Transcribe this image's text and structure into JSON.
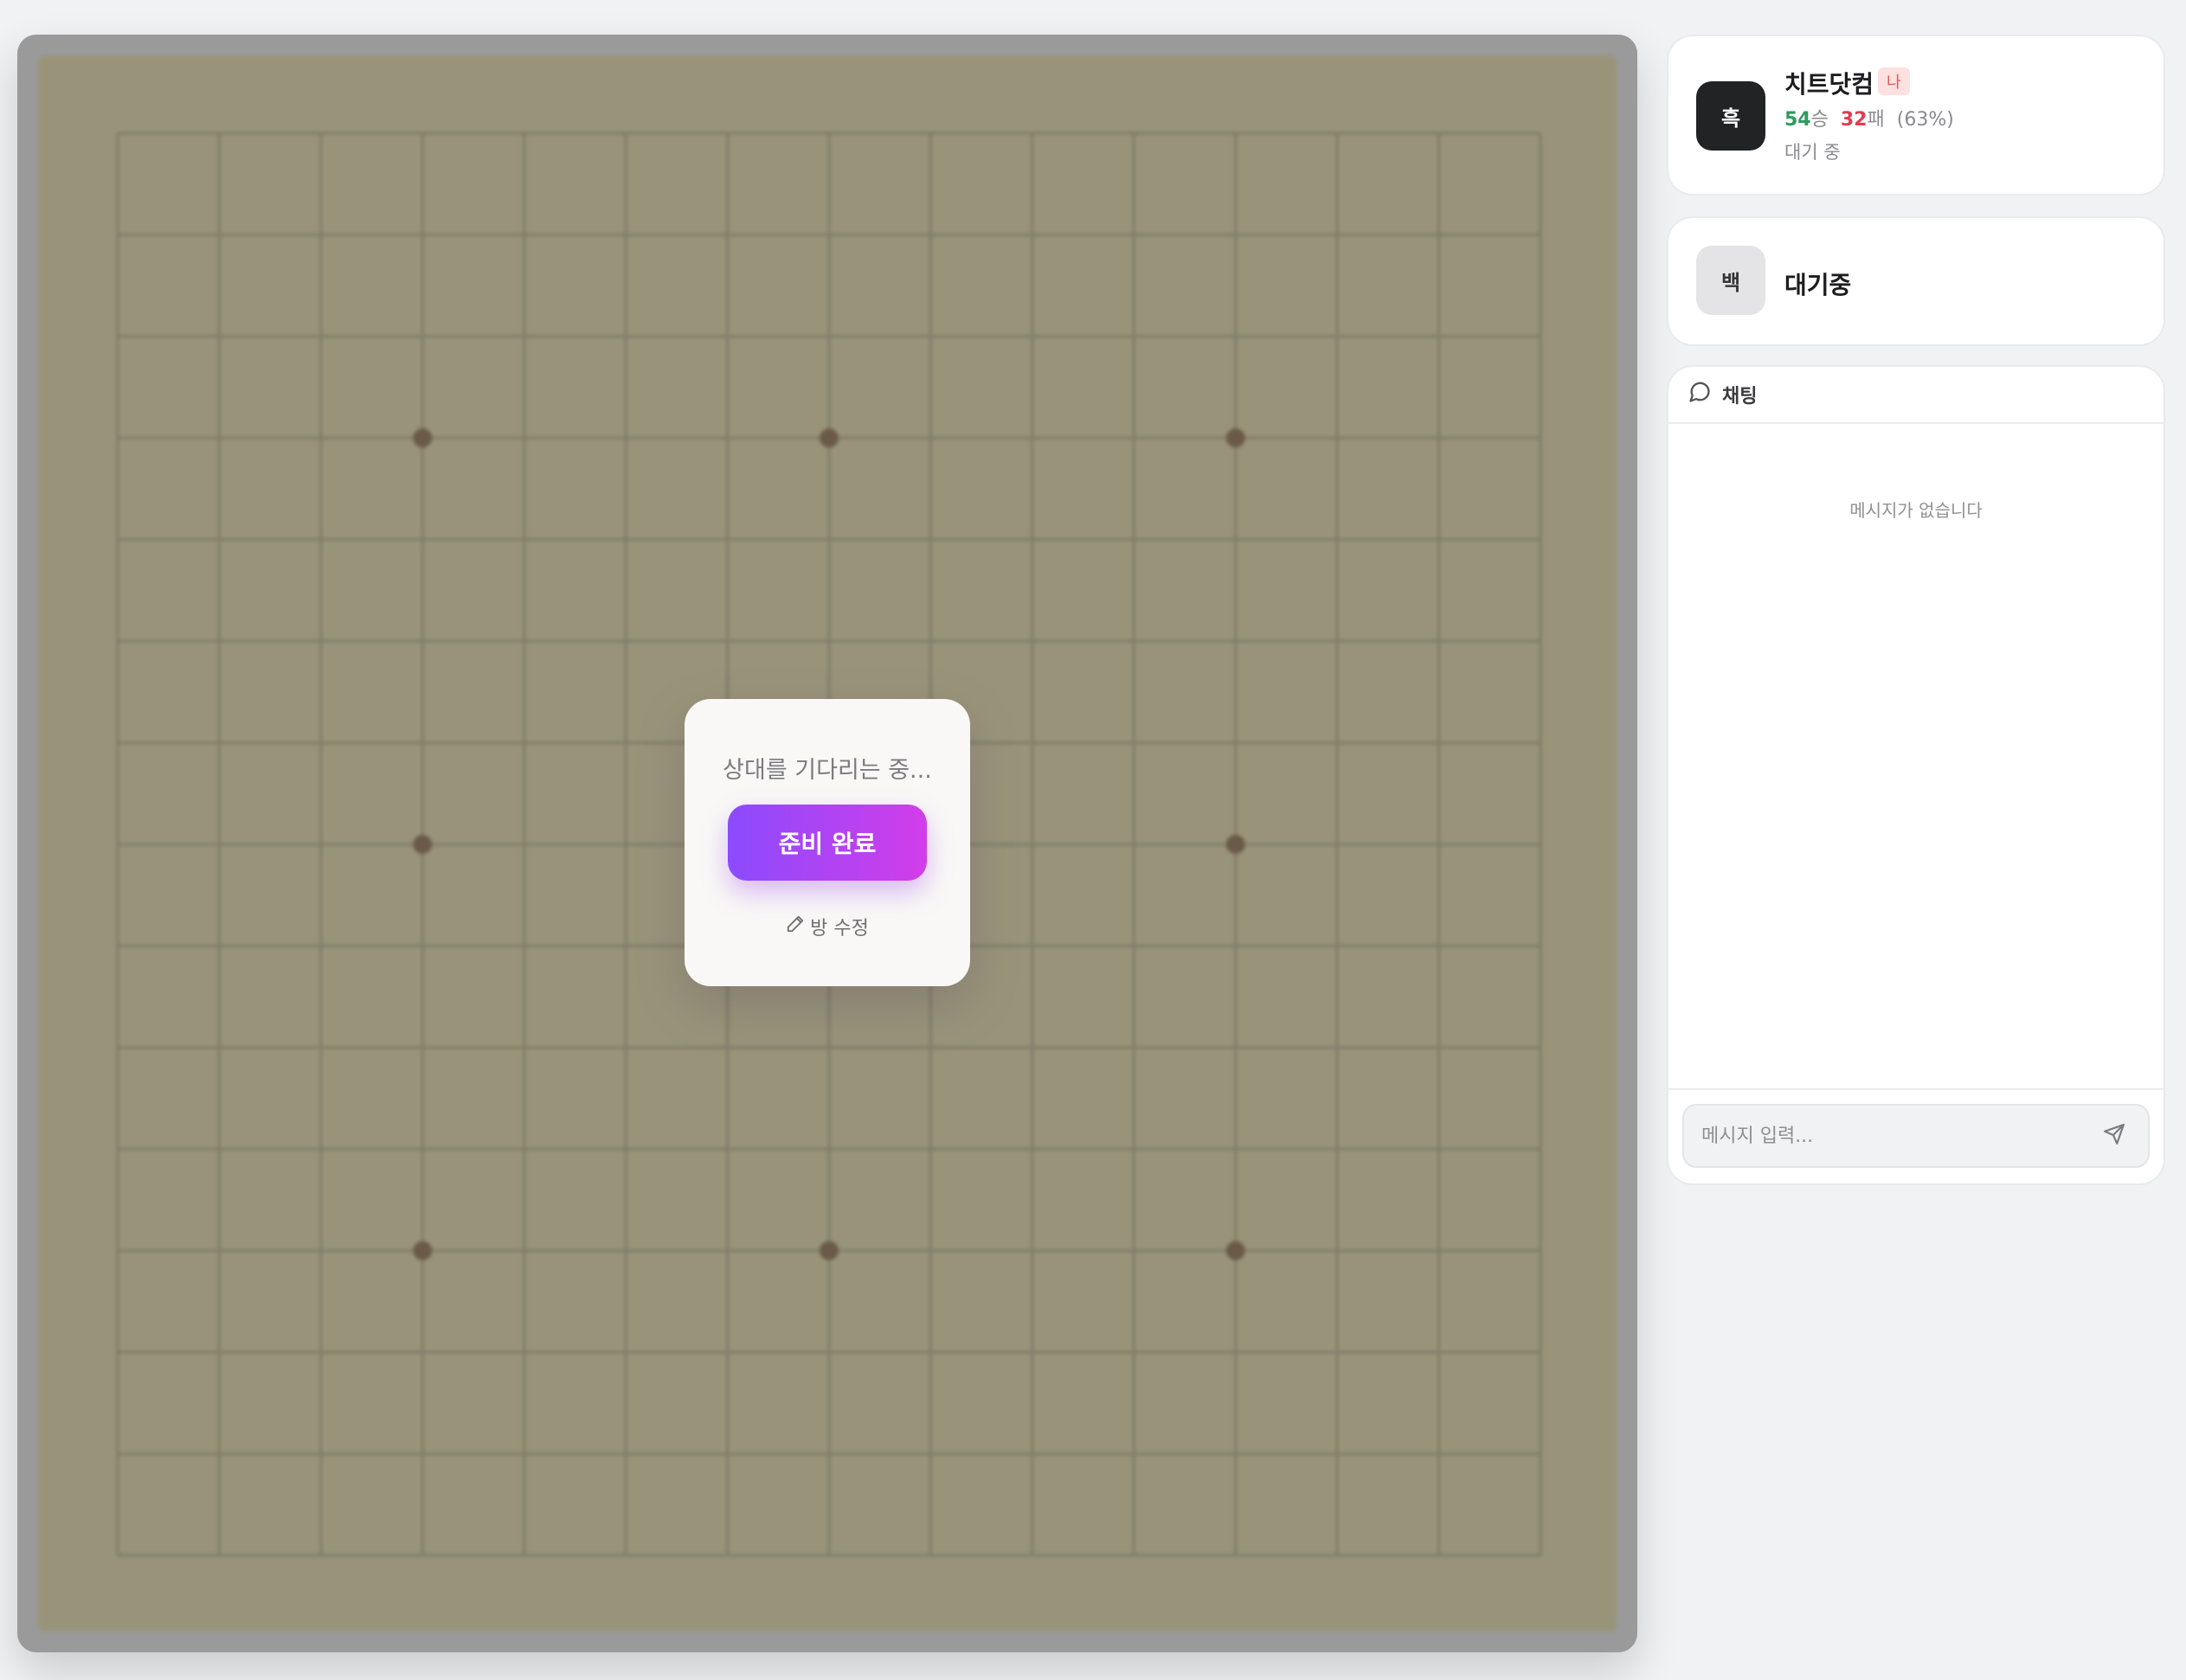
{
  "board": {
    "size": 15,
    "star_points": [
      [
        3,
        3
      ],
      [
        7,
        3
      ],
      [
        11,
        3
      ],
      [
        3,
        7
      ],
      [
        11,
        7
      ],
      [
        3,
        11
      ],
      [
        7,
        11
      ],
      [
        11,
        11
      ]
    ]
  },
  "modal": {
    "waiting_text": "상대를 기다리는 중...",
    "ready_label": "준비 완료",
    "edit_room_label": "방 수정"
  },
  "player_black": {
    "avatar_label": "흑",
    "name": "치트닷컴",
    "me_badge": "나",
    "wins": "54",
    "wins_suffix": "승",
    "losses": "32",
    "losses_suffix": "패",
    "win_rate": "(63%)",
    "status": "대기 중"
  },
  "player_white": {
    "avatar_label": "백",
    "name": "대기중"
  },
  "chat": {
    "title": "채팅",
    "empty_text": "메시지가 없습니다",
    "input_placeholder": "메시지 입력..."
  },
  "colors": {
    "board": "#999479",
    "accent_start": "#8b4bfd",
    "accent_end": "#d23de9",
    "win": "#2f9a5c",
    "loss": "#e13b4f"
  }
}
